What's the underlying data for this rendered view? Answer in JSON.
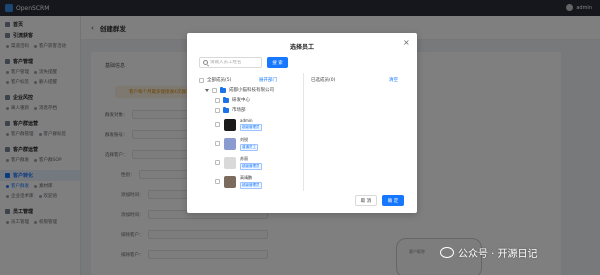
{
  "app": {
    "logo_text": "OpenSCRM",
    "user": "admin"
  },
  "sidebar": {
    "home": "首页",
    "groups": [
      {
        "label": "引流获客",
        "rows": [
          [
            "渠道活码",
            "客户获客活动"
          ]
        ]
      },
      {
        "label": "客户管理",
        "rows": [
          [
            "客户管理",
            "流失提醒"
          ],
          [
            "客户标签",
            "删人提醒"
          ]
        ]
      },
      {
        "label": "企业风控",
        "rows": [
          [
            "离人重新",
            "消息存档"
          ]
        ]
      },
      {
        "label": "客户群运营",
        "rows": [
          [
            "客户群管理",
            "客户群标签"
          ]
        ]
      },
      {
        "label": "客户群运营",
        "rows": [
          [
            "客户群发",
            "客户群SOP"
          ]
        ]
      },
      {
        "label": "客户转化",
        "rows": [
          [
            "客户群发",
            "素材库"
          ],
          [
            "企业话术库",
            "欢迎语"
          ]
        ]
      },
      {
        "label": "员工管理",
        "rows": [
          [
            "员工管理",
            "权限管理"
          ]
        ]
      },
      {
        "label": "",
        "rows": []
      }
    ]
  },
  "page": {
    "back_icon": "back-arrow",
    "title": "创建群发",
    "section_title": "基础信息",
    "warning_text": "客户每个月最多能接收4次群发信息",
    "rows": [
      "群发对象：",
      "群发账号：",
      "选择客户：",
      "性别：",
      "添加时间：",
      "添加时间：",
      "排除客户：",
      "排除客户："
    ],
    "phone_preview": "客户昵称"
  },
  "modal": {
    "title": "选择员工",
    "search_placeholder": "请输入员工姓名",
    "search_button": "搜 索",
    "all_members": "全部成员(5)",
    "expand_link": "展开部门",
    "selected_label": "已选成员(0)",
    "clear_link": "清空",
    "company": "成都小猫科技有限公司",
    "departments": [
      "研发中心",
      "市场部"
    ],
    "members": [
      {
        "name": "admin",
        "tag": "超级管理员",
        "color": "#1a1a1a"
      },
      {
        "name": "刘锐",
        "tag": "普通员工",
        "color": "#8a9bd0"
      },
      {
        "name": "苏丽",
        "tag": "超级管理员",
        "color": "#d9d9d9"
      },
      {
        "name": "高靖鹏",
        "tag": "超级管理员",
        "color": "#7b6a5e"
      }
    ],
    "cancel": "取 消",
    "ok": "确 定"
  },
  "watermark": {
    "text": "公众号 · 开源日记"
  }
}
